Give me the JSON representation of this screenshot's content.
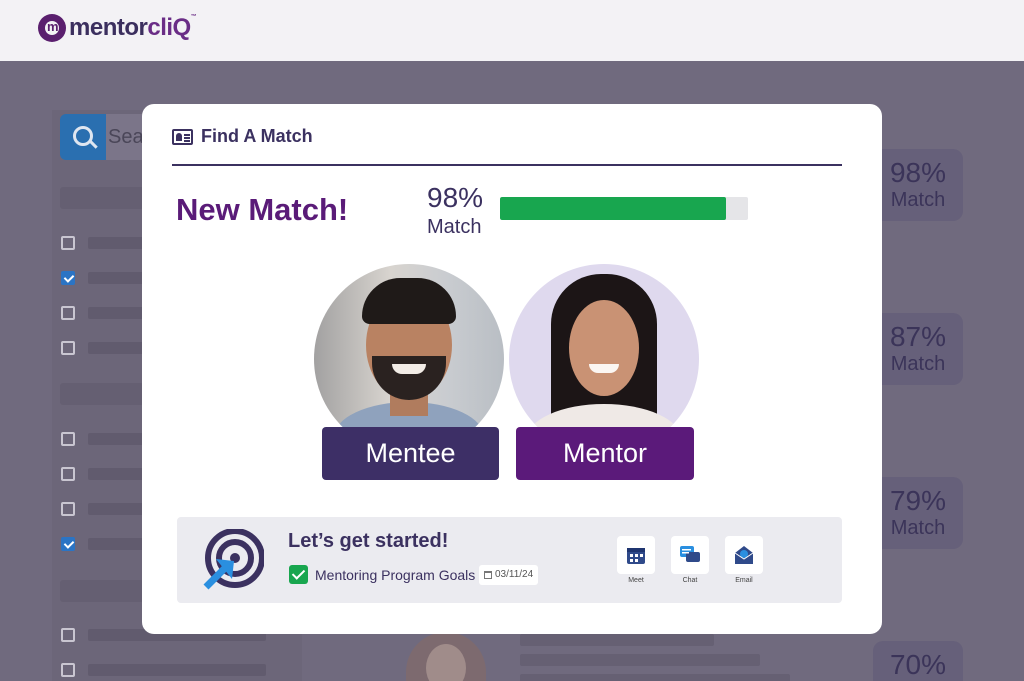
{
  "header": {
    "logo": {
      "part1": "mentor",
      "part2": "cliQ",
      "trademark": "™"
    }
  },
  "background": {
    "search_placeholder": "Sear",
    "match_cards": [
      {
        "percent": "98%",
        "label": "Match"
      },
      {
        "percent": "87%",
        "label": "Match"
      },
      {
        "percent": "79%",
        "label": "Match"
      },
      {
        "percent": "70%",
        "label": ""
      }
    ]
  },
  "modal": {
    "title": "Find A Match",
    "headline": "New Match!",
    "match_percent": "98%",
    "match_label": "Match",
    "match_progress": 0.91,
    "mentee_label": "Mentee",
    "mentor_label": "Mentor",
    "card": {
      "title": "Let’s get started!",
      "goal": "Mentoring Program Goals",
      "date": "03/11/24",
      "actions": [
        {
          "label": "Meet",
          "icon": "calendar-icon"
        },
        {
          "label": "Chat",
          "icon": "chat-icon"
        },
        {
          "label": "Email",
          "icon": "email-icon"
        }
      ]
    }
  },
  "colors": {
    "brand_purple": "#5a1b78",
    "navy": "#3b3160",
    "progress_green": "#18a64f",
    "overlay": "#706a7e"
  }
}
